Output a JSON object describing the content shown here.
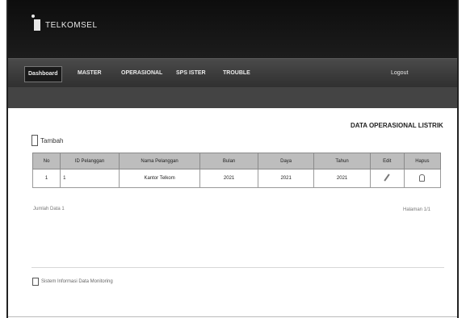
{
  "app": {
    "logo_text": "TELKOMSEL"
  },
  "nav": {
    "items": [
      {
        "label": "Dashboard"
      },
      {
        "label": "MASTER"
      },
      {
        "label": "OPERASIONAL"
      },
      {
        "label": "SPS ISTER"
      },
      {
        "label": "TROUBLE"
      }
    ],
    "user_label": "Logout"
  },
  "panel": {
    "title": "DATA OPERASIONAL LISTRIK",
    "add_label": "Tambah"
  },
  "table": {
    "headers": [
      "No",
      "ID Pelanggan",
      "Nama Pelanggan",
      "Bulan",
      "Daya",
      "Tahun",
      "Edit",
      "Hapus"
    ],
    "rows": [
      {
        "no": "1",
        "id": "1",
        "nama": "Kantor Telkom",
        "bulan": "2021",
        "daya": "2021",
        "tahun": "2021"
      }
    ]
  },
  "pagination": {
    "left_text": "Jumlah Data 1",
    "right_text": "Halaman 1/1"
  },
  "footer": {
    "link_text": "Sistem Informasi Data Monitoring"
  }
}
